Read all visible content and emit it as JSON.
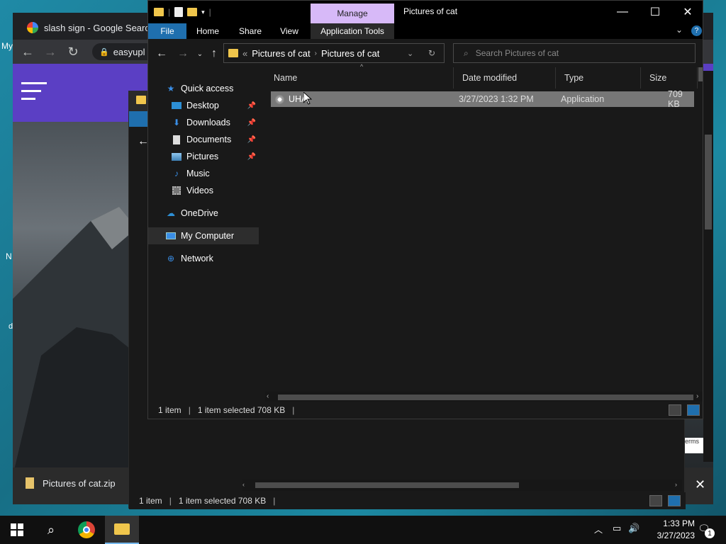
{
  "desktop": {
    "icons": [
      {
        "label": "My"
      },
      {
        "label": "N"
      },
      {
        "label": "d"
      }
    ]
  },
  "chrome": {
    "tab_title": "slash sign - Google Search",
    "omnibox": "easyupl",
    "download_item": "Pictures of cat.zip",
    "partial_text": "erms"
  },
  "explorer_back": {
    "status_items": "1 item",
    "status_selected": "1 item selected  708 KB"
  },
  "explorer": {
    "manage_label": "Manage",
    "window_title": "Pictures of cat",
    "ribbon_tabs": {
      "file": "File",
      "home": "Home",
      "share": "Share",
      "view": "View",
      "app_tools": "Application Tools"
    },
    "address": {
      "prefix": "«",
      "crumb1": "Pictures of cat",
      "crumb2": "Pictures of cat"
    },
    "search_placeholder": "Search Pictures of cat",
    "nav": {
      "quick_access": "Quick access",
      "desktop": "Desktop",
      "downloads": "Downloads",
      "documents": "Documents",
      "pictures": "Pictures",
      "music": "Music",
      "videos": "Videos",
      "onedrive": "OneDrive",
      "my_computer": "My Computer",
      "network": "Network"
    },
    "columns": {
      "name": "Name",
      "date": "Date modified",
      "type": "Type",
      "size": "Size"
    },
    "files": [
      {
        "name": "UHA",
        "date": "3/27/2023 1:32 PM",
        "type": "Application",
        "size": "709 KB"
      }
    ],
    "status_items": "1 item",
    "status_selected": "1 item selected  708 KB"
  },
  "taskbar": {
    "time": "1:33 PM",
    "date": "3/27/2023",
    "notif_count": "1"
  },
  "colors": {
    "accent": "#1f6fae",
    "manage": "#d7b9f8",
    "selection": "#777777"
  }
}
